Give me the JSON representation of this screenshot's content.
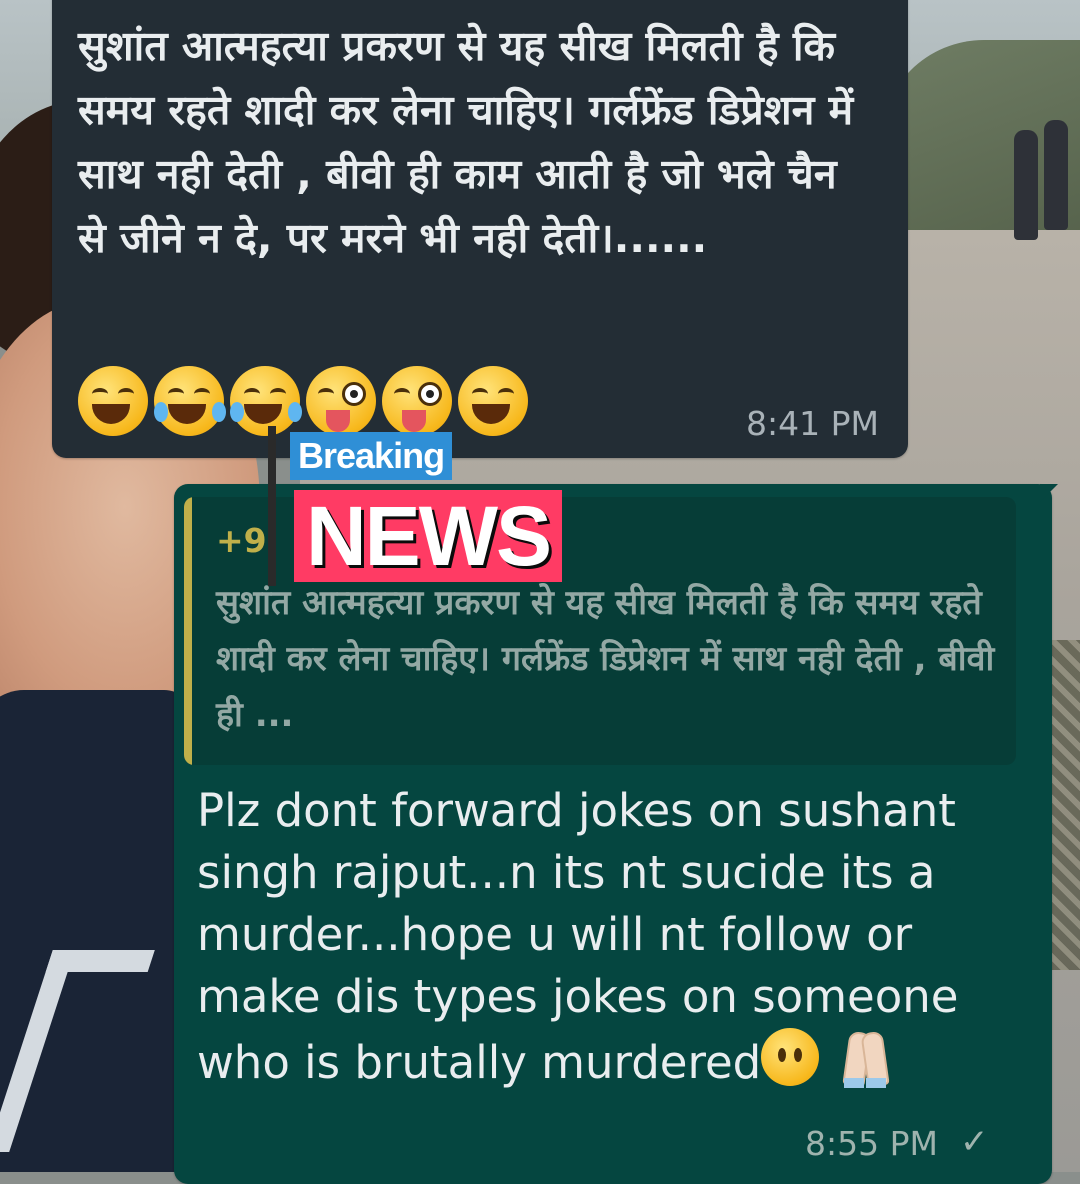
{
  "chat": {
    "incoming": {
      "text": "सुशांत आत्महत्या प्रकरण से यह सीख मिलती है कि समय रहते शादी कर लेना चाहिए। गर्लफ्रेंड डिप्रेशन में साथ नही देती , बीवी ही काम आती है जो भले चैन से जीने न दे, पर मरने भी नही देती।......",
      "emojis": [
        "laughing-squint",
        "tears-of-joy",
        "tears-of-joy",
        "winking-tongue",
        "winking-tongue",
        "laughing-squint"
      ],
      "time": "8:41 PM"
    },
    "outgoing": {
      "quoted_sender": "+9",
      "quoted_text": "सुशांत आत्महत्या प्रकरण से यह सीख मिलती है कि समय रहते शादी कर लेना चाहिए। गर्लफ्रेंड डिप्रेशन में साथ नही देती , बीवी ही ...",
      "text": "Plz dont forward jokes on sushant singh rajput...n its nt sucide its a murder...hope u will nt follow or make dis types jokes on someone who is brutally murdered",
      "trailing_emojis": [
        "neutral-face",
        "folded-hands"
      ],
      "time": "8:55 PM",
      "status_mark": "✓"
    }
  },
  "sticker": {
    "line1": "Breaking",
    "line2": "NEWS"
  },
  "colors": {
    "incoming_bubble": "#232d35",
    "outgoing_bubble": "#054640",
    "quote_accent": "#c0b04a",
    "sticker_blue": "#2f8fd6",
    "sticker_red": "#ff3b64"
  }
}
